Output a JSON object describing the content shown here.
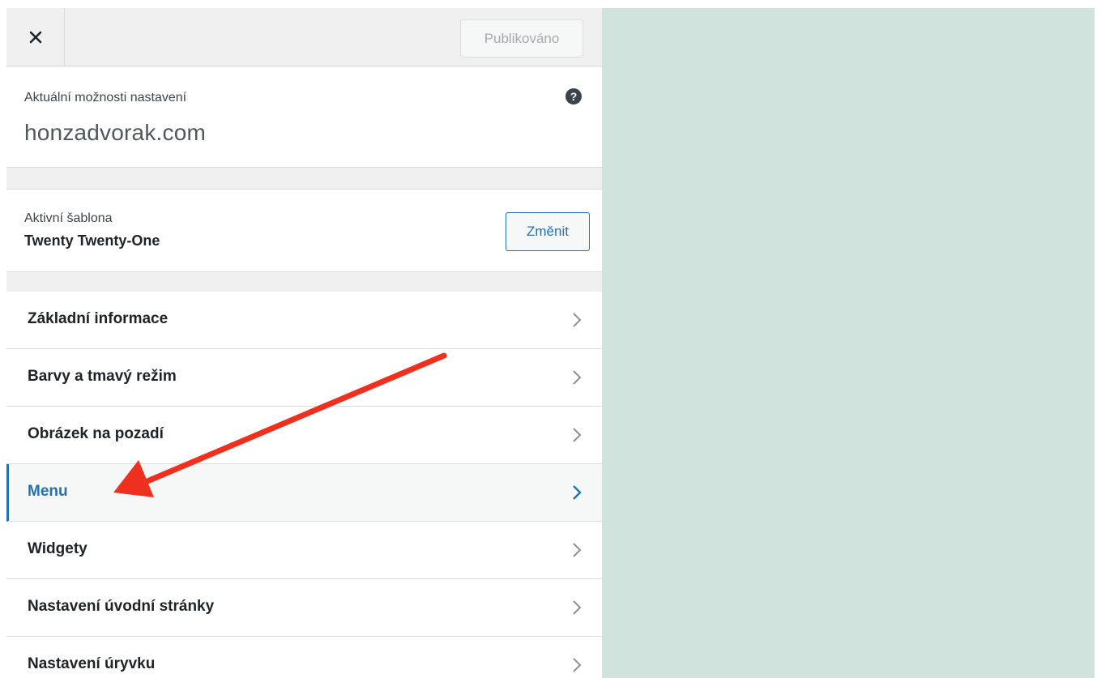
{
  "header": {
    "close_label": "×",
    "publish_label": "Publikováno"
  },
  "info": {
    "label": "Aktuální možnosti nastavení",
    "site": "honzadvorak.com",
    "help_icon": "question-circle-icon"
  },
  "theme": {
    "label": "Aktivní šablona",
    "name": "Twenty Twenty-One",
    "change_label": "Změnit"
  },
  "menu": {
    "items": [
      {
        "label": "Základní informace",
        "active": false
      },
      {
        "label": "Barvy a tmavý režim",
        "active": false
      },
      {
        "label": "Obrázek na pozadí",
        "active": false
      },
      {
        "label": "Menu",
        "active": true
      },
      {
        "label": "Widgety",
        "active": false
      },
      {
        "label": "Nastavení úvodní stránky",
        "active": false
      },
      {
        "label": "Nastavení úryvku",
        "active": false
      }
    ]
  },
  "colors": {
    "accent": "#2271b1",
    "preview_bg": "#d0e3dd",
    "annotation_arrow": "#f0301e"
  }
}
